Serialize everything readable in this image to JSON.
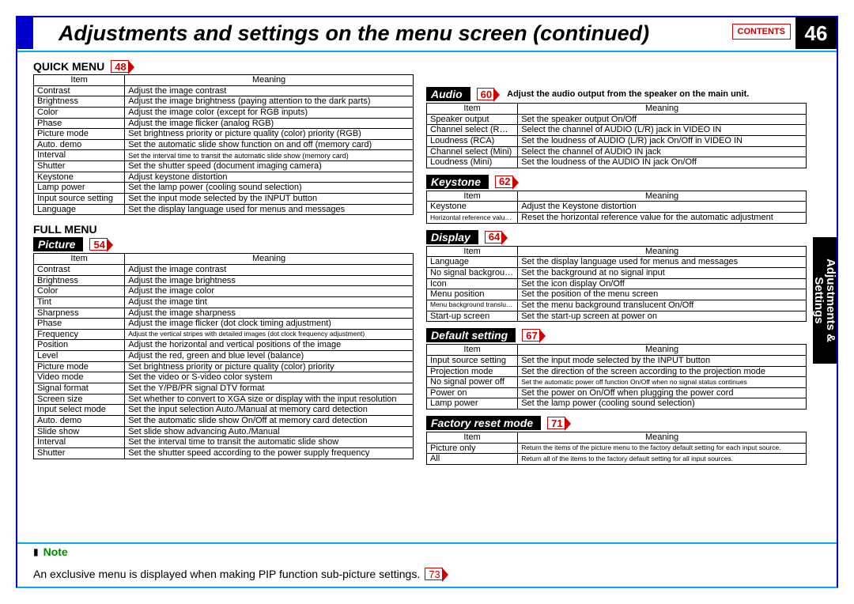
{
  "page": {
    "title": "Adjustments and settings on the menu screen (continued)",
    "contents_btn": "CONTENTS",
    "number": "46",
    "side_tab": "Adjustments &\nSettings"
  },
  "quick_menu": {
    "heading": "QUICK MENU",
    "page_ref": "48",
    "columns": [
      "Item",
      "Meaning"
    ],
    "rows": [
      [
        "Contrast",
        "Adjust the image contrast"
      ],
      [
        "Brightness",
        "Adjust the image brightness (paying attention to the dark parts)"
      ],
      [
        "Color",
        "Adjust the image color (except for RGB inputs)"
      ],
      [
        "Phase",
        "Adjust the image flicker (analog RGB)"
      ],
      [
        "Picture mode",
        "Set brightness priority or picture quality (color) priority (RGB)"
      ],
      [
        "Auto. demo",
        "Set the automatic slide show function on and off (memory card)"
      ],
      [
        "Interval",
        "Set the interval time to transit the automatic slide show (memory card)"
      ],
      [
        "Shutter",
        "Set the shutter speed (document imaging camera)"
      ],
      [
        "Keystone",
        "Adjust keystone distortion"
      ],
      [
        "Lamp power",
        "Set the lamp power (cooling sound selection)"
      ],
      [
        "Input source setting",
        "Set the input mode selected by the INPUT button"
      ],
      [
        "Language",
        "Set the display language used for menus and messages"
      ]
    ]
  },
  "full_menu": {
    "heading": "FULL MENU",
    "picture": {
      "label": "Picture",
      "page_ref": "54",
      "columns": [
        "Item",
        "Meaning"
      ],
      "rows": [
        [
          "Contrast",
          "Adjust the image contrast"
        ],
        [
          "Brightness",
          "Adjust the image brightness"
        ],
        [
          "Color",
          "Adjust the image color"
        ],
        [
          "Tint",
          "Adjust the image tint"
        ],
        [
          "Sharpness",
          "Adjust the image sharpness"
        ],
        [
          "Phase",
          "Adjust the image flicker (dot clock timing adjustment)"
        ],
        [
          "Frequency",
          "Adjust the vertical stripes with detailed images (dot clock frequency adjustment)"
        ],
        [
          "Position",
          "Adjust the horizontal and vertical positions of the image"
        ],
        [
          "Level",
          "Adjust the red, green and blue level (balance)"
        ],
        [
          "Picture mode",
          "Set brightness priority or picture quality (color) priority"
        ],
        [
          "Video mode",
          "Set the video or S-video color system"
        ],
        [
          "Signal format",
          "Set the Y/PB/PR signal DTV format"
        ],
        [
          "Screen size",
          "Set whether to convert to XGA size or display with the input resolution"
        ],
        [
          "Input select mode",
          "Set the input selection Auto./Manual at memory card detection"
        ],
        [
          "Auto. demo",
          "Set the automatic slide show On/Off at memory card detection"
        ],
        [
          "Slide show",
          "Set slide show advancing Auto./Manual"
        ],
        [
          "Interval",
          "Set the interval time to transit the automatic slide show"
        ],
        [
          "Shutter",
          "Set the shutter speed according to the power supply frequency"
        ]
      ]
    }
  },
  "audio": {
    "label": "Audio",
    "page_ref": "60",
    "desc": "Adjust the audio output from the speaker on the main unit.",
    "columns": [
      "Item",
      "Meaning"
    ],
    "rows": [
      [
        "Speaker output",
        "Set the speaker output On/Off"
      ],
      [
        "Channel select (RCA)",
        "Select the channel of AUDIO (L/R) jack in VIDEO IN"
      ],
      [
        "Loudness (RCA)",
        "Set the loudness of AUDIO (L/R) jack On/Off in VIDEO IN"
      ],
      [
        "Channel select (Mini)",
        "Select the channel of AUDIO IN jack"
      ],
      [
        "Loudness (Mini)",
        "Set the loudness of the AUDIO IN jack On/Off"
      ]
    ]
  },
  "keystone": {
    "label": "Keystone",
    "page_ref": "62",
    "columns": [
      "Item",
      "Meaning"
    ],
    "rows": [
      [
        "Keystone",
        "Adjust the Keystone distortion"
      ],
      [
        "Horizontal reference value reset",
        "Reset the horizontal reference value for the automatic adjustment"
      ]
    ]
  },
  "display": {
    "label": "Display",
    "page_ref": "64",
    "columns": [
      "Item",
      "Meaning"
    ],
    "rows": [
      [
        "Language",
        "Set the display language used for menus and messages"
      ],
      [
        "No signal background",
        "Set the background at no signal input"
      ],
      [
        "Icon",
        "Set the icon display On/Off"
      ],
      [
        "Menu position",
        "Set the position of the menu screen"
      ],
      [
        "Menu background translucent",
        "Set the menu background translucent On/Off"
      ],
      [
        "Start-up screen",
        "Set the start-up screen at power on"
      ]
    ]
  },
  "default_setting": {
    "label": "Default setting",
    "page_ref": "67",
    "columns": [
      "Item",
      "Meaning"
    ],
    "rows": [
      [
        "Input source setting",
        "Set the input mode selected by the INPUT button"
      ],
      [
        "Projection mode",
        "Set the direction of the screen according to the projection mode"
      ],
      [
        "No signal power off",
        "Set the automatic power off function On/Off when no signal status continues"
      ],
      [
        "Power on",
        "Set the power on On/Off when plugging the power cord"
      ],
      [
        "Lamp power",
        "Set the lamp power (cooling sound selection)"
      ]
    ]
  },
  "factory_reset": {
    "label": "Factory reset mode",
    "page_ref": "71",
    "columns": [
      "Item",
      "Meaning"
    ],
    "rows": [
      [
        "Picture only",
        "Return the items of the picture menu to the factory default setting for each input source."
      ],
      [
        "All",
        "Return all of the items to the factory default setting for all input sources."
      ]
    ]
  },
  "note": {
    "label": "Note",
    "text": "An exclusive menu is displayed when making PIP function sub-picture settings.",
    "page_ref": "73"
  }
}
